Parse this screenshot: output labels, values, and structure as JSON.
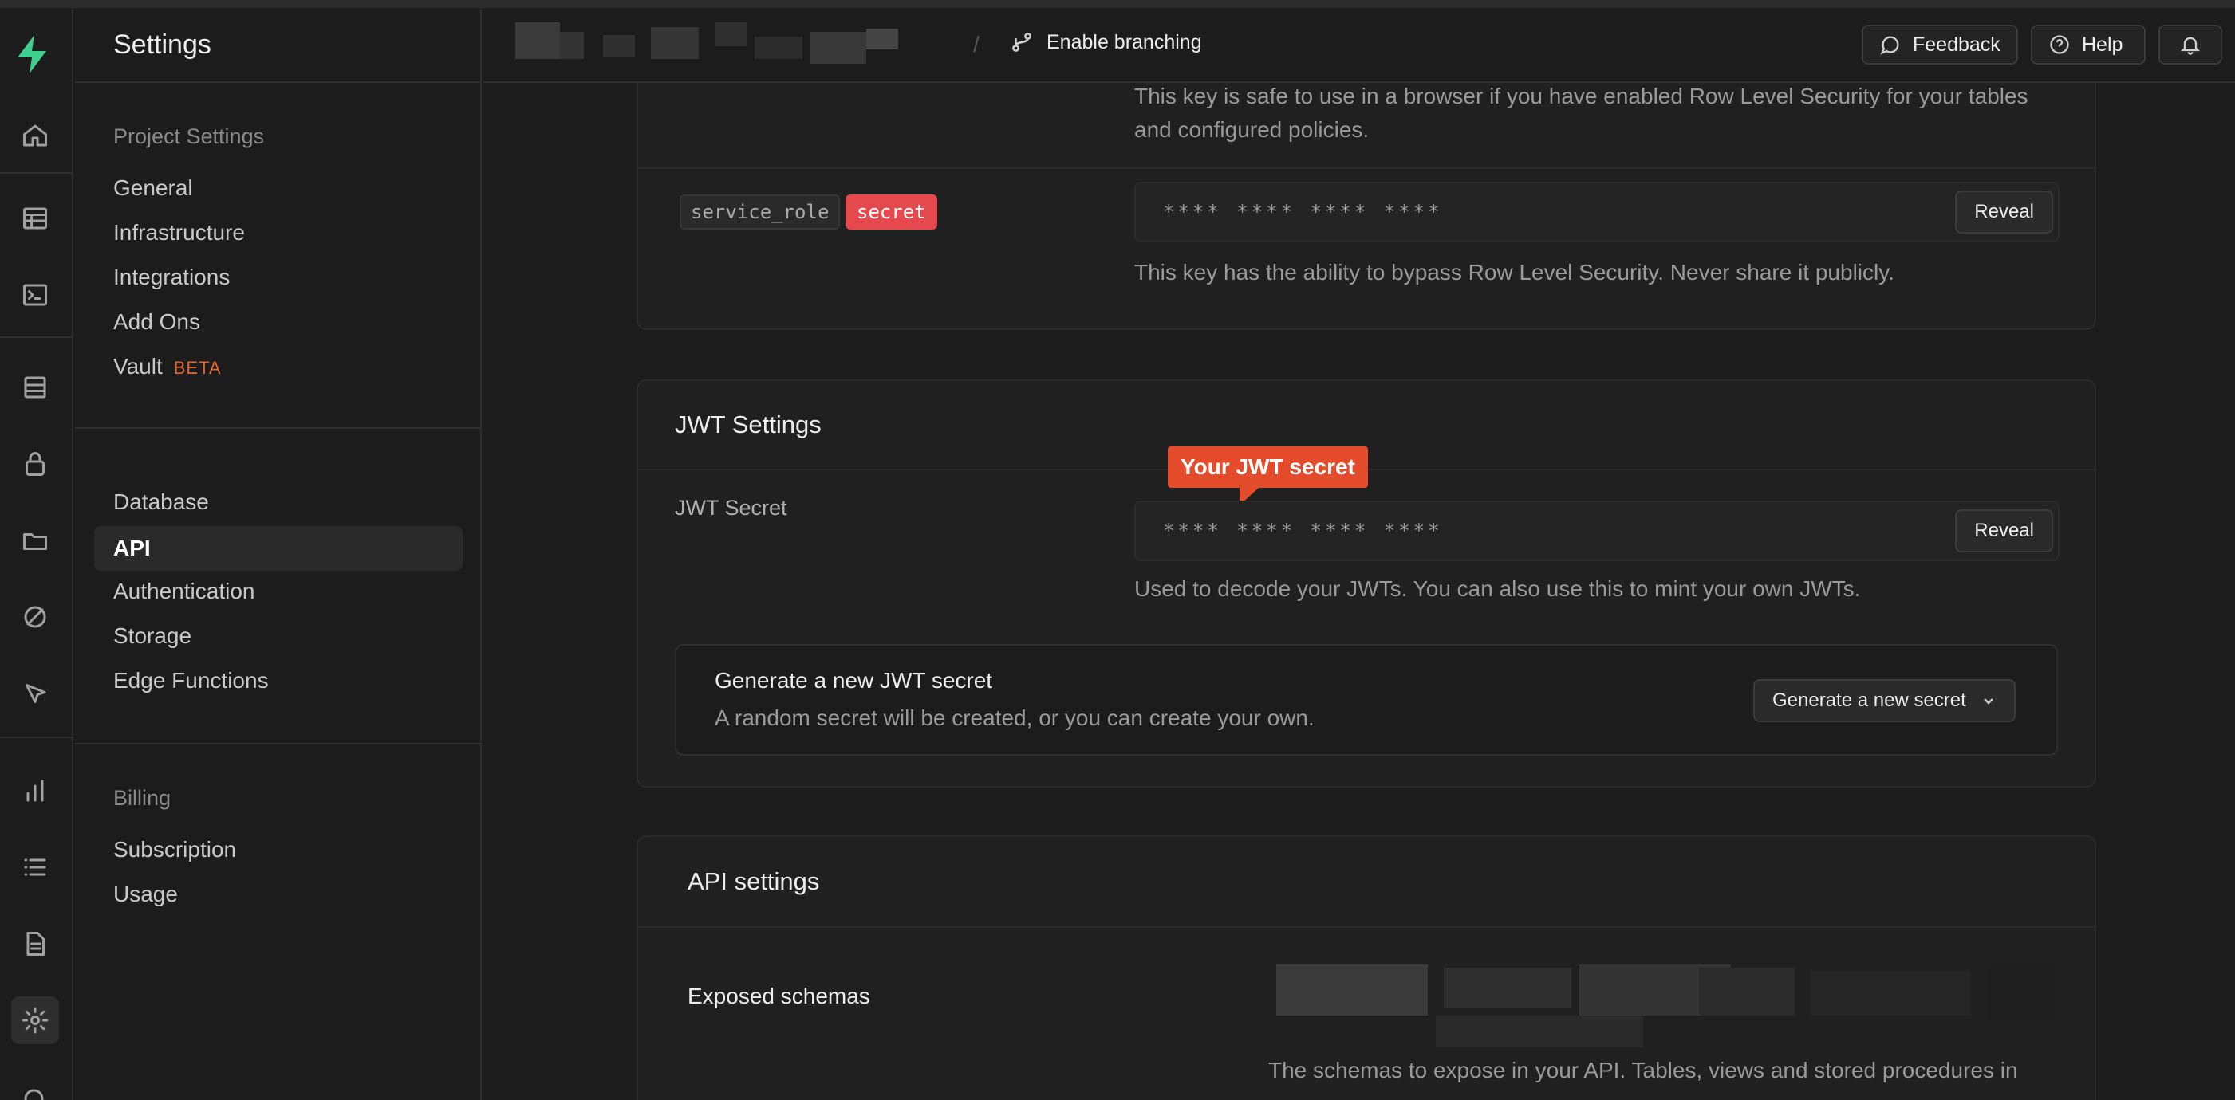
{
  "sidebar_title": "Settings",
  "topbar": {
    "branch_label": "Enable branching",
    "feedback_label": "Feedback",
    "help_label": "Help"
  },
  "nav_groups": {
    "project_settings": {
      "title": "Project Settings",
      "items": [
        "General",
        "Infrastructure",
        "Integrations",
        "Add Ons",
        "Vault"
      ],
      "vault_badge": "BETA"
    },
    "config": {
      "items": [
        "Database",
        "API",
        "Authentication",
        "Storage",
        "Edge Functions"
      ],
      "active": "API"
    },
    "billing": {
      "title": "Billing",
      "items": [
        "Subscription",
        "Usage"
      ]
    }
  },
  "api_keys": {
    "anon_note": "This key is safe to use in a browser if you have enabled Row Level Security for your tables and configured policies.",
    "service_role_tag": "service_role",
    "secret_tag": "secret",
    "service_role_masked": "**** **** **** ****",
    "reveal_label": "Reveal",
    "service_role_note": "This key has the ability to bypass Row Level Security. Never share it publicly."
  },
  "jwt": {
    "title": "JWT Settings",
    "secret_label": "JWT Secret",
    "callout": "Your JWT secret",
    "masked": "**** **** **** ****",
    "reveal_label": "Reveal",
    "note": "Used to decode your JWTs. You can also use this to mint your own JWTs.",
    "generate_title": "Generate a new JWT secret",
    "generate_desc": "A random secret will be created, or you can create your own.",
    "generate_button": "Generate a new secret"
  },
  "api_settings": {
    "title": "API settings",
    "exposed_label": "Exposed schemas",
    "exposed_desc": "The schemas to expose in your API. Tables, views and stored procedures in"
  },
  "colors": {
    "brand": "#3ecf8e",
    "secret_tag_bg": "#e5484d",
    "callout_bg": "#e44b2b",
    "beta": "#e5662a"
  }
}
